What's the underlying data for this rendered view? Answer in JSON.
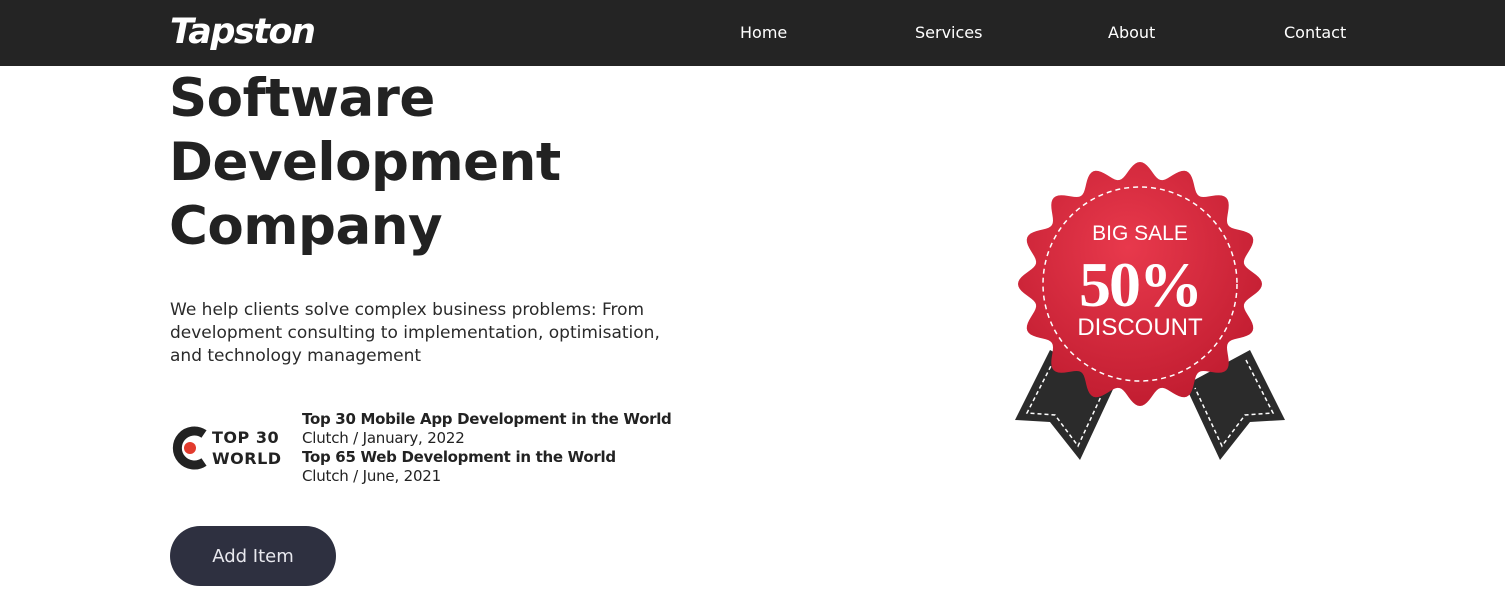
{
  "header": {
    "logo": "Tapston",
    "nav": [
      {
        "label": "Home"
      },
      {
        "label": "Services"
      },
      {
        "label": "About"
      },
      {
        "label": "Contact"
      }
    ]
  },
  "hero": {
    "title_lines": [
      "Software",
      "Development",
      "Company"
    ],
    "description": "We help clients solve complex business problems: From development consulting to implementation, optimisation, and technology management"
  },
  "award_logo": {
    "line1": "TOP 30",
    "line2": "WORLD"
  },
  "awards": [
    {
      "title": "Top 30 Mobile App Development in the World",
      "source": "Clutch",
      "date": "January, 2022"
    },
    {
      "title": "Top 65 Web Development in the World",
      "source": "Clutch",
      "date": "June, 2021"
    }
  ],
  "cta": {
    "label": "Add Item"
  },
  "badge": {
    "line1": "BIG SALE",
    "line2": "50%",
    "line3": "DISCOUNT",
    "color": "#d7263b",
    "ribbon_color": "#2b2b2b"
  },
  "colors": {
    "navbar": "#242424",
    "button": "#2e3040",
    "accent": "#e23b2e"
  }
}
